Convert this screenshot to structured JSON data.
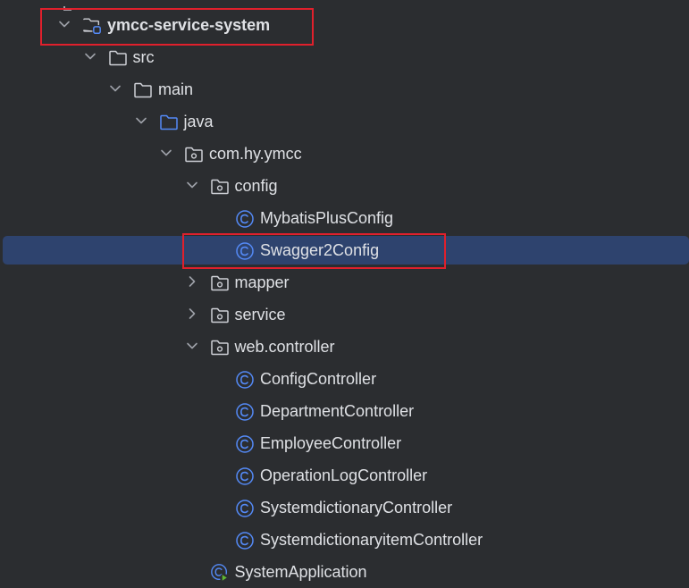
{
  "tree": [
    {
      "key": "root",
      "label": "ymcc-service-system",
      "level": 0,
      "expanded": true,
      "icon": "module-folder-icon",
      "bold": true
    },
    {
      "key": "src",
      "label": "src",
      "level": 1,
      "expanded": true,
      "icon": "folder-icon"
    },
    {
      "key": "main",
      "label": "main",
      "level": 2,
      "expanded": true,
      "icon": "folder-icon"
    },
    {
      "key": "java",
      "label": "java",
      "level": 3,
      "expanded": true,
      "icon": "source-folder-icon"
    },
    {
      "key": "pkg",
      "label": "com.hy.ymcc",
      "level": 4,
      "expanded": true,
      "icon": "package-icon"
    },
    {
      "key": "config",
      "label": "config",
      "level": 5,
      "expanded": true,
      "icon": "package-icon"
    },
    {
      "key": "mybatis",
      "label": "MybatisPlusConfig",
      "level": 6,
      "icon": "class-icon"
    },
    {
      "key": "swagger",
      "label": "Swagger2Config",
      "level": 6,
      "icon": "class-icon",
      "selected": true
    },
    {
      "key": "mapper",
      "label": "mapper",
      "level": 5,
      "expanded": false,
      "icon": "package-icon"
    },
    {
      "key": "service",
      "label": "service",
      "level": 5,
      "expanded": false,
      "icon": "package-icon"
    },
    {
      "key": "webctrl",
      "label": "web.controller",
      "level": 5,
      "expanded": true,
      "icon": "package-icon"
    },
    {
      "key": "cfgctrl",
      "label": "ConfigController",
      "level": 6,
      "icon": "class-icon"
    },
    {
      "key": "deptctrl",
      "label": "DepartmentController",
      "level": 6,
      "icon": "class-icon"
    },
    {
      "key": "empctrl",
      "label": "EmployeeController",
      "level": 6,
      "icon": "class-icon"
    },
    {
      "key": "oplogctrl",
      "label": "OperationLogController",
      "level": 6,
      "icon": "class-icon"
    },
    {
      "key": "sysdictctrl",
      "label": "SystemdictionaryController",
      "level": 6,
      "icon": "class-icon"
    },
    {
      "key": "sysdictitemctrl",
      "label": "SystemdictionaryitemController",
      "level": 6,
      "icon": "class-icon"
    },
    {
      "key": "sysapp",
      "label": "SystemApplication",
      "level": 5,
      "icon": "spring-boot-class-icon"
    }
  ],
  "highlights": [
    "root",
    "swagger"
  ],
  "colors": {
    "background": "#2b2d30",
    "selection": "#2e436e",
    "text": "#dfe1e5",
    "chevron": "#9da0a8",
    "folder": "#ced0d6",
    "source_folder": "#548af7",
    "class_icon": "#548af7",
    "spring_green": "#5fb832",
    "highlight_box": "#e0202c"
  }
}
